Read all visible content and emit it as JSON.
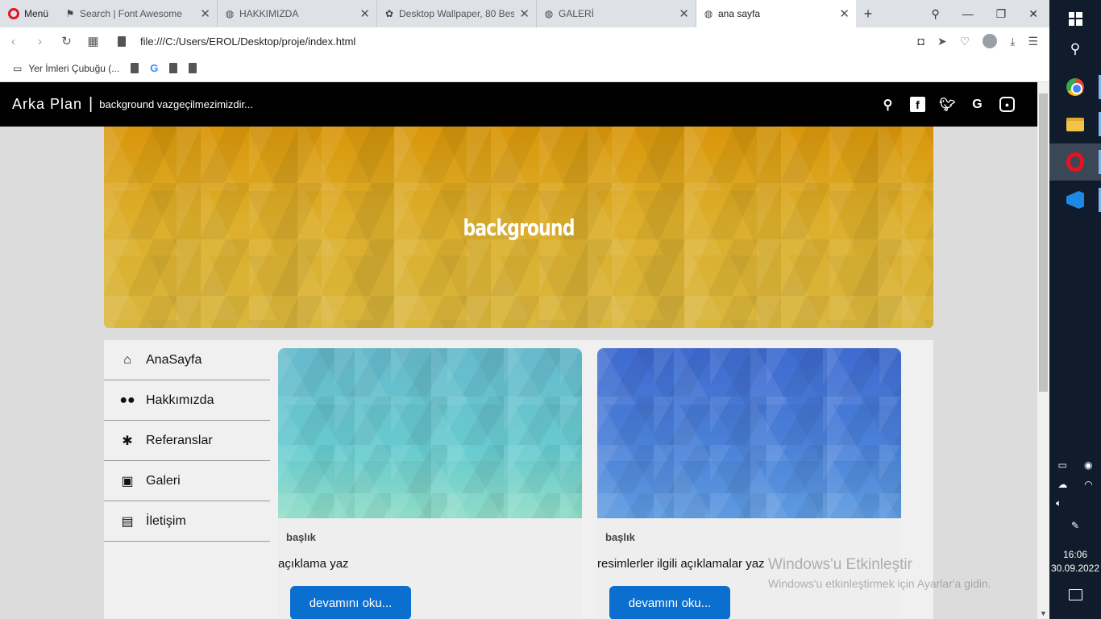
{
  "browser": {
    "menu_label": "Menü",
    "tabs": [
      {
        "title": "Search | Font Awesome",
        "icon": "flag-icon"
      },
      {
        "title": "HAKKIMIZDA",
        "icon": "globe-icon"
      },
      {
        "title": "Desktop Wallpaper, 80 Best",
        "icon": "gear-icon"
      },
      {
        "title": "GALERİ",
        "icon": "globe-icon"
      },
      {
        "title": "ana sayfa",
        "icon": "globe-icon",
        "active": true
      }
    ],
    "address": "file:///C:/Users/EROL/Desktop/proje/index.html",
    "bookmarks_label": "Yer İmleri Çubuğu (..."
  },
  "site": {
    "brand": "Arka Plan",
    "brand_separator": "|",
    "tagline": "background vazgeçilmezimizdir...",
    "hero_title": "background",
    "sidebar": [
      {
        "label": "AnaSayfa",
        "icon": "home-icon"
      },
      {
        "label": "Hakkımızda",
        "icon": "users-icon"
      },
      {
        "label": "Referanslar",
        "icon": "asterisk-icon"
      },
      {
        "label": "Galeri",
        "icon": "images-icon"
      },
      {
        "label": "İletişim",
        "icon": "address-book-icon"
      }
    ],
    "cards": [
      {
        "title": "başlık",
        "description": "açıklama yaz",
        "button": "devamını oku..."
      },
      {
        "title": "başlık",
        "description": "resimlerler ilgili açıklamalar yaz",
        "button": "devamını oku..."
      }
    ]
  },
  "watermark": {
    "title": "Windows'u Etkinleştir",
    "subtitle": "Windows'u etkinleştirmek için Ayarlar'a gidin."
  },
  "taskbar": {
    "time": "16:06",
    "date": "30.09.2022"
  }
}
